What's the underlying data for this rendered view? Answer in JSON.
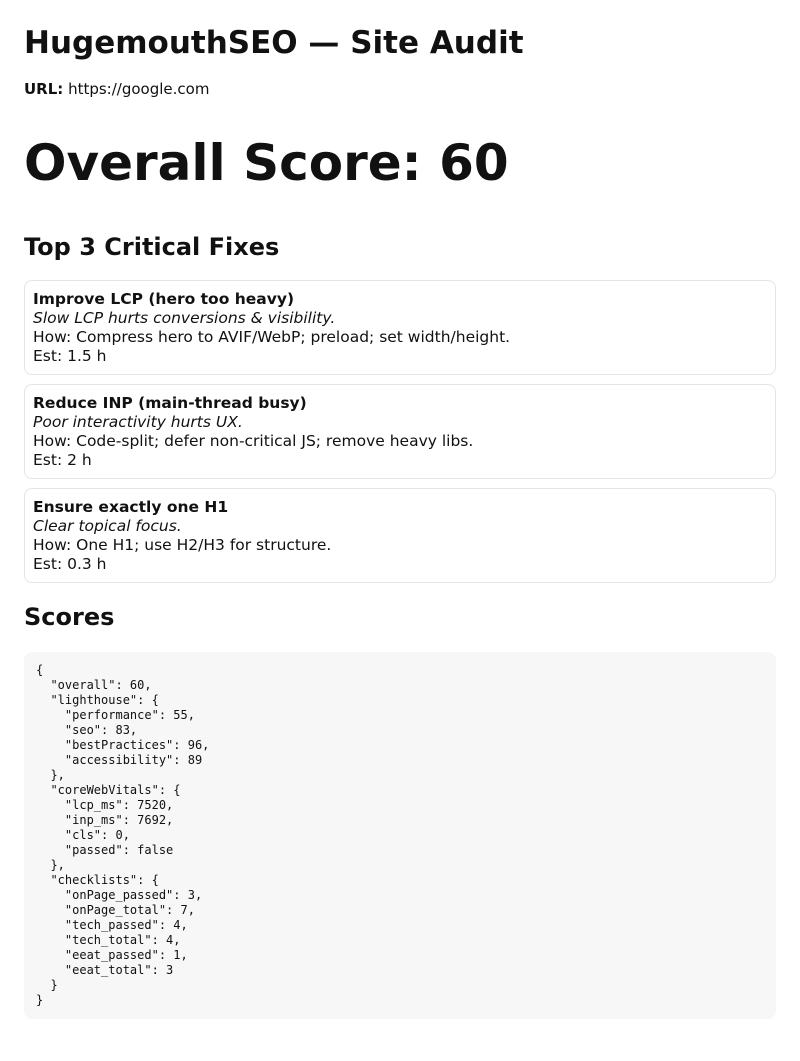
{
  "header": {
    "title": "HugemouthSEO — Site Audit",
    "url_label": "URL:",
    "url_value": "https://google.com"
  },
  "overall": {
    "text": "Overall Score: 60"
  },
  "fixes": {
    "heading": "Top 3 Critical Fixes",
    "items": [
      {
        "title": "Improve LCP (hero too heavy)",
        "why": "Slow LCP hurts conversions & visibility.",
        "how": "How: Compress hero to AVIF/WebP; preload; set width/height.",
        "est": "Est: 1.5 h"
      },
      {
        "title": "Reduce INP (main-thread busy)",
        "why": "Poor interactivity hurts UX.",
        "how": "How: Code-split; defer non-critical JS; remove heavy libs.",
        "est": "Est: 2 h"
      },
      {
        "title": "Ensure exactly one H1",
        "why": "Clear topical focus.",
        "how": "How: One H1; use H2/H3 for structure.",
        "est": "Est: 0.3 h"
      }
    ]
  },
  "scores": {
    "heading": "Scores",
    "json_text": "{\n  \"overall\": 60,\n  \"lighthouse\": {\n    \"performance\": 55,\n    \"seo\": 83,\n    \"bestPractices\": 96,\n    \"accessibility\": 89\n  },\n  \"coreWebVitals\": {\n    \"lcp_ms\": 7520,\n    \"inp_ms\": 7692,\n    \"cls\": 0,\n    \"passed\": false\n  },\n  \"checklists\": {\n    \"onPage_passed\": 3,\n    \"onPage_total\": 7,\n    \"tech_passed\": 4,\n    \"tech_total\": 4,\n    \"eeat_passed\": 1,\n    \"eeat_total\": 3\n  }\n}"
  }
}
